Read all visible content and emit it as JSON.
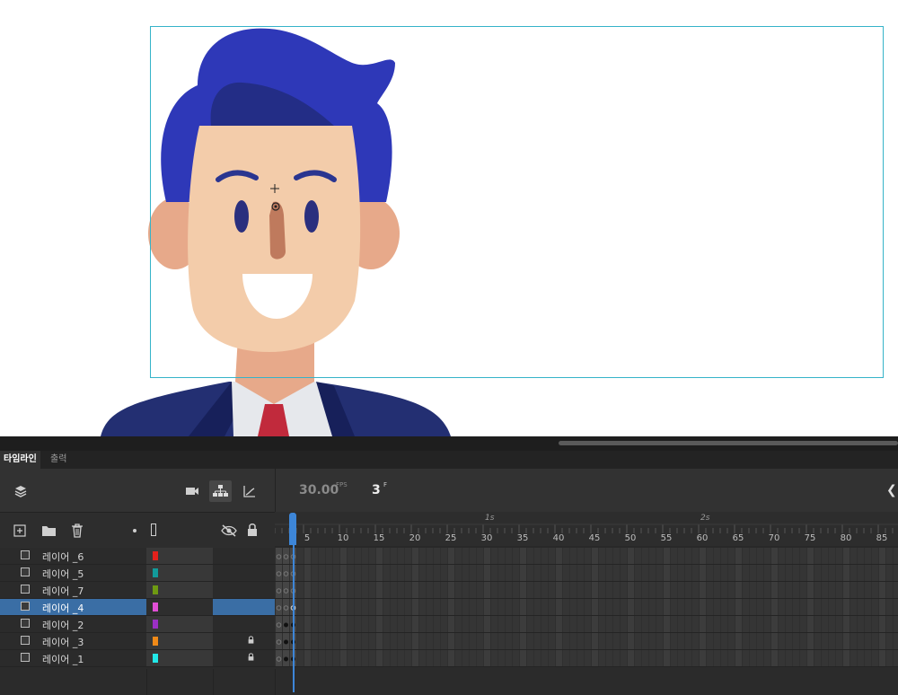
{
  "tabs": {
    "timeline": "타임라인",
    "output": "출력"
  },
  "playback": {
    "fps": "30.00",
    "fps_unit": "FPS",
    "current_frame": "3",
    "frame_unit": "F"
  },
  "ruler": {
    "ticks": [
      "5",
      "10",
      "15",
      "20",
      "25",
      "30",
      "35",
      "40",
      "45",
      "50",
      "55",
      "60",
      "65",
      "70",
      "75",
      "80",
      "85"
    ],
    "seconds": [
      "1s",
      "2s"
    ]
  },
  "layers": [
    {
      "name": "레이어 _6",
      "color": "#e3211c",
      "locked": false,
      "selected": false
    },
    {
      "name": "레이어 _5",
      "color": "#129a9a",
      "locked": false,
      "selected": false
    },
    {
      "name": "레이어 _7",
      "color": "#6e9a12",
      "locked": false,
      "selected": false
    },
    {
      "name": "레이어 _4",
      "color": "#e14fd6",
      "locked": false,
      "selected": true
    },
    {
      "name": "레이어 _2",
      "color": "#9b2fc4",
      "locked": false,
      "selected": false
    },
    {
      "name": "레이어 _3",
      "color": "#f08a18",
      "locked": true,
      "selected": false
    },
    {
      "name": "레이어 _1",
      "color": "#22e8e8",
      "locked": true,
      "selected": false
    }
  ],
  "icons": {
    "layers": "layers-icon",
    "camera": "camera-icon",
    "parenting": "layer-parenting-icon",
    "graph": "graph-icon",
    "new_layer": "new-layer-icon",
    "new_folder": "new-folder-icon",
    "delete": "trash-icon",
    "collapse": "chevron-left-icon"
  },
  "colors": {
    "accent": "#3d86d8",
    "selected_row": "#3a6ea5",
    "panel_bg": "#2b2b2b",
    "stage_border": "#35b3c9"
  }
}
